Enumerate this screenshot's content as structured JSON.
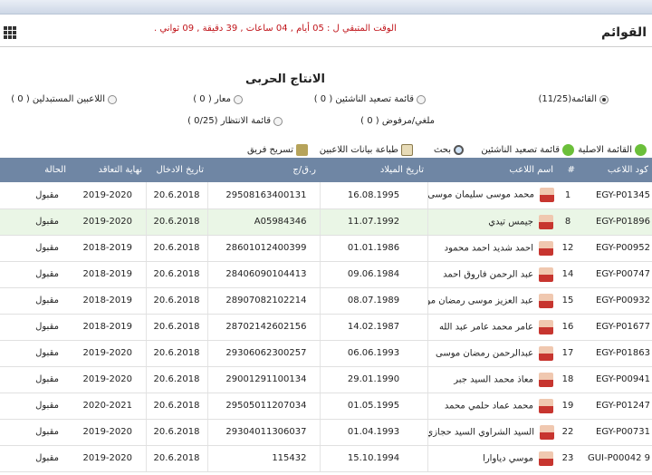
{
  "header": {
    "brand": "القوائم",
    "countdown": "الوقت المتبقي ل : 05 أيام , 04 ساعات , 39 دقيقة , 09 ثواني ."
  },
  "section_title": "الانتاج الحربى",
  "radios": [
    {
      "label": "القائمة(11/25)",
      "checked": true
    },
    {
      "label": "قائمة تصعيد الناشئين ( 0 )",
      "checked": false
    },
    {
      "label": "معار ( 0 )",
      "checked": false
    },
    {
      "label": "اللاعبين المستبدلين ( 0 )",
      "checked": false
    },
    {
      "label": "ملغي/مرفوض ( 0 )",
      "checked": false
    },
    {
      "label": "قائمة الانتظار (0/25 )",
      "checked": false
    }
  ],
  "toolbar": {
    "original_list": "القائمة الاصلية",
    "promotion_list": "قائمة تصعيد الناشئين",
    "search": "بحث",
    "print": "طباعة بيانات اللاعبين",
    "release": "تسريح فريق"
  },
  "columns": [
    "كود اللاعب",
    "#",
    "اسم اللاعب",
    "تاريخ الميلاد",
    "ر.ق/ج",
    "تاريخ الادخال",
    "نهاية التعاقد",
    "الحالة"
  ],
  "rows": [
    {
      "code": "EGY-P01345",
      "num": "1",
      "name": "محمد موسى سليمان موسى",
      "birth": "16.08.1995",
      "nid": "29508163400131",
      "entry": "20.6.2018",
      "contract": "2019-2020",
      "status": "مقبول"
    },
    {
      "code": "EGY-P01896",
      "num": "8",
      "name": "جيمس تيدي",
      "birth": "11.07.1992",
      "nid": "A05984346",
      "entry": "20.6.2018",
      "contract": "2019-2020",
      "status": "مقبول"
    },
    {
      "code": "EGY-P00952",
      "num": "12",
      "name": "احمد شديد احمد محمود",
      "birth": "01.01.1986",
      "nid": "28601012400399",
      "entry": "20.6.2018",
      "contract": "2018-2019",
      "status": "مقبول"
    },
    {
      "code": "EGY-P00747",
      "num": "14",
      "name": "عبد الرحمن فاروق احمد",
      "birth": "09.06.1984",
      "nid": "28406090104413",
      "entry": "20.6.2018",
      "contract": "2018-2019",
      "status": "مقبول"
    },
    {
      "code": "EGY-P00932",
      "num": "15",
      "name": "عبد العزيز موسى رمضان موسى",
      "birth": "08.07.1989",
      "nid": "28907082102214",
      "entry": "20.6.2018",
      "contract": "2018-2019",
      "status": "مقبول"
    },
    {
      "code": "EGY-P01677",
      "num": "16",
      "name": "عامر محمد عامر عبد الله",
      "birth": "14.02.1987",
      "nid": "28702142602156",
      "entry": "20.6.2018",
      "contract": "2018-2019",
      "status": "مقبول"
    },
    {
      "code": "EGY-P01863",
      "num": "17",
      "name": "عبدالرحمن رمضان موسى",
      "birth": "06.06.1993",
      "nid": "29306062300257",
      "entry": "20.6.2018",
      "contract": "2019-2020",
      "status": "مقبول"
    },
    {
      "code": "EGY-P00941",
      "num": "18",
      "name": "معاذ محمد السيد جبر",
      "birth": "29.01.1990",
      "nid": "29001291100134",
      "entry": "20.6.2018",
      "contract": "2019-2020",
      "status": "مقبول"
    },
    {
      "code": "EGY-P01247",
      "num": "19",
      "name": "محمد عماد حلمي محمد",
      "birth": "01.05.1995",
      "nid": "29505011207034",
      "entry": "20.6.2018",
      "contract": "2020-2021",
      "status": "مقبول"
    },
    {
      "code": "EGY-P00731",
      "num": "22",
      "name": "السيد الشراوي السيد حجازي",
      "birth": "01.04.1993",
      "nid": "29304011306037",
      "entry": "20.6.2018",
      "contract": "2019-2020",
      "status": "مقبول"
    },
    {
      "code": "GUI-P00042 9",
      "num": "23",
      "name": "موسي دياوارا",
      "birth": "15.10.1994",
      "nid": "115432",
      "entry": "20.6.2018",
      "contract": "2019-2020",
      "status": "مقبول"
    }
  ],
  "colors": {
    "header_bg": "#6f86a4",
    "countdown": "#c0141a",
    "highlight_row": "#eaf6e6"
  }
}
